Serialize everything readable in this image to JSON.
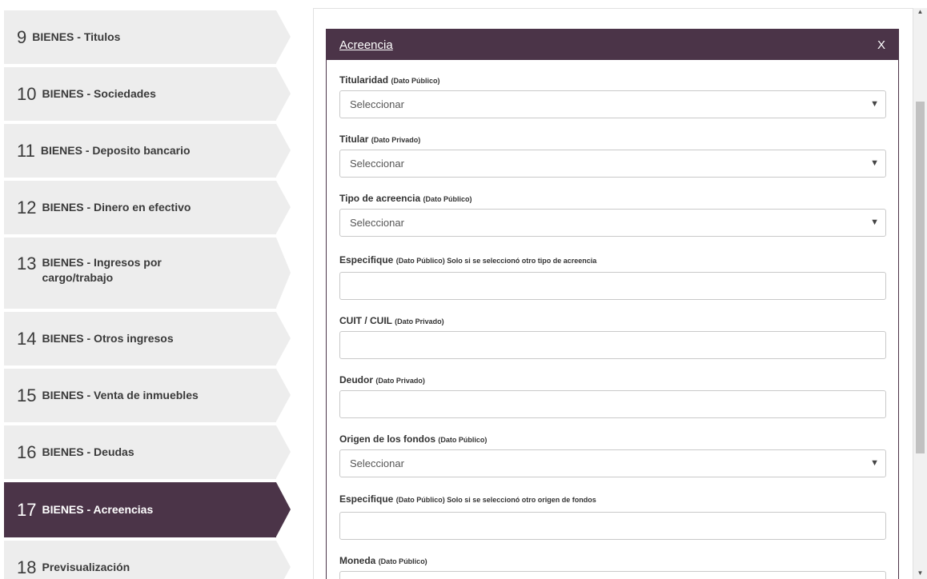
{
  "steps": [
    {
      "num": "9",
      "label": "BIENES - Titulos"
    },
    {
      "num": "10",
      "label": "BIENES - Sociedades"
    },
    {
      "num": "11",
      "label": "BIENES - Deposito bancario"
    },
    {
      "num": "12",
      "label": "BIENES - Dinero en efectivo"
    },
    {
      "num": "13",
      "label": "BIENES - Ingresos por cargo/trabajo"
    },
    {
      "num": "14",
      "label": "BIENES - Otros ingresos"
    },
    {
      "num": "15",
      "label": "BIENES - Venta de inmuebles"
    },
    {
      "num": "16",
      "label": "BIENES - Deudas"
    },
    {
      "num": "17",
      "label": "BIENES - Acreencias"
    },
    {
      "num": "18",
      "label": "Previsualización"
    }
  ],
  "modal": {
    "title": "Acreencia",
    "close": "X"
  },
  "fields": {
    "titularidad": {
      "label": "Titularidad",
      "note": "(Dato Público)",
      "value": "Seleccionar"
    },
    "titular": {
      "label": "Titular",
      "note": "(Dato Privado)",
      "value": "Seleccionar"
    },
    "tipo": {
      "label": "Tipo de acreencia",
      "note": "(Dato Público)",
      "value": "Seleccionar"
    },
    "especifique1": {
      "label": "Especifique",
      "note": "(Dato Público) Solo si se seleccionó otro tipo de acreencia",
      "value": ""
    },
    "cuit": {
      "label": "CUIT / CUIL",
      "note": "(Dato Privado)",
      "value": ""
    },
    "deudor": {
      "label": "Deudor",
      "note": "(Dato Privado)",
      "value": ""
    },
    "origen": {
      "label": "Origen de los fondos",
      "note": "(Dato Público)",
      "value": "Seleccionar"
    },
    "especifique2": {
      "label": "Especifique",
      "note": "(Dato Público) Solo si se seleccionó otro origen de fondos",
      "value": ""
    },
    "moneda": {
      "label": "Moneda",
      "note": "(Dato Público)",
      "value": ""
    }
  },
  "icons": {
    "dropdown": "▼",
    "scroll_up": "▲",
    "scroll_down": "▼"
  },
  "colors": {
    "accent": "#4b3448",
    "step_bg": "#ededed"
  }
}
